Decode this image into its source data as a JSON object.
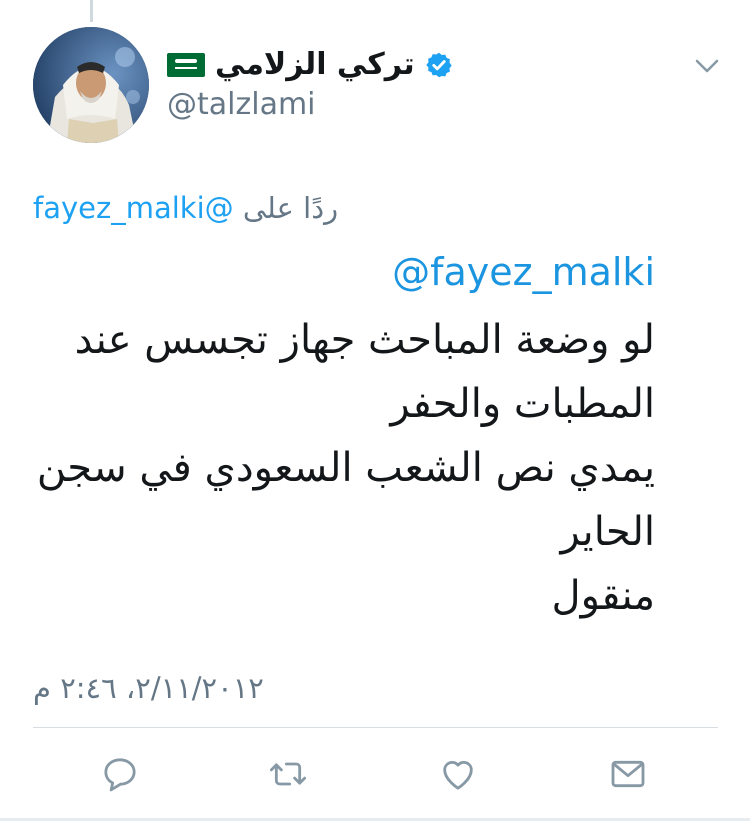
{
  "colors": {
    "accent": "#1da1f2",
    "link": "#1b95e0",
    "text": "#14171a",
    "secondary": "#657786",
    "divider": "#d8dde1",
    "flag_green": "#006c35"
  },
  "author": {
    "display_name": "تركي الزلامي",
    "handle": "@talzlami",
    "verified": true,
    "flag_icon": "saudi-flag-icon",
    "verified_icon": "verified-badge-icon"
  },
  "reply_context": {
    "label": "ردًا على",
    "mention": "@fayez_malki"
  },
  "tweet": {
    "mention": "@fayez_malki",
    "lines": [
      "لو وضعة المباحث جهاز تجسس عند",
      "المطبات والحفر",
      "يمدي نص الشعب السعودي في سجن",
      "الحاير",
      "منقول"
    ]
  },
  "timestamp": "٢/١١/٢٠١٢، ٢:٤٦ م",
  "actions": [
    {
      "name": "reply",
      "icon": "reply-icon"
    },
    {
      "name": "retweet",
      "icon": "retweet-icon"
    },
    {
      "name": "like",
      "icon": "heart-icon"
    },
    {
      "name": "message",
      "icon": "envelope-icon"
    }
  ]
}
